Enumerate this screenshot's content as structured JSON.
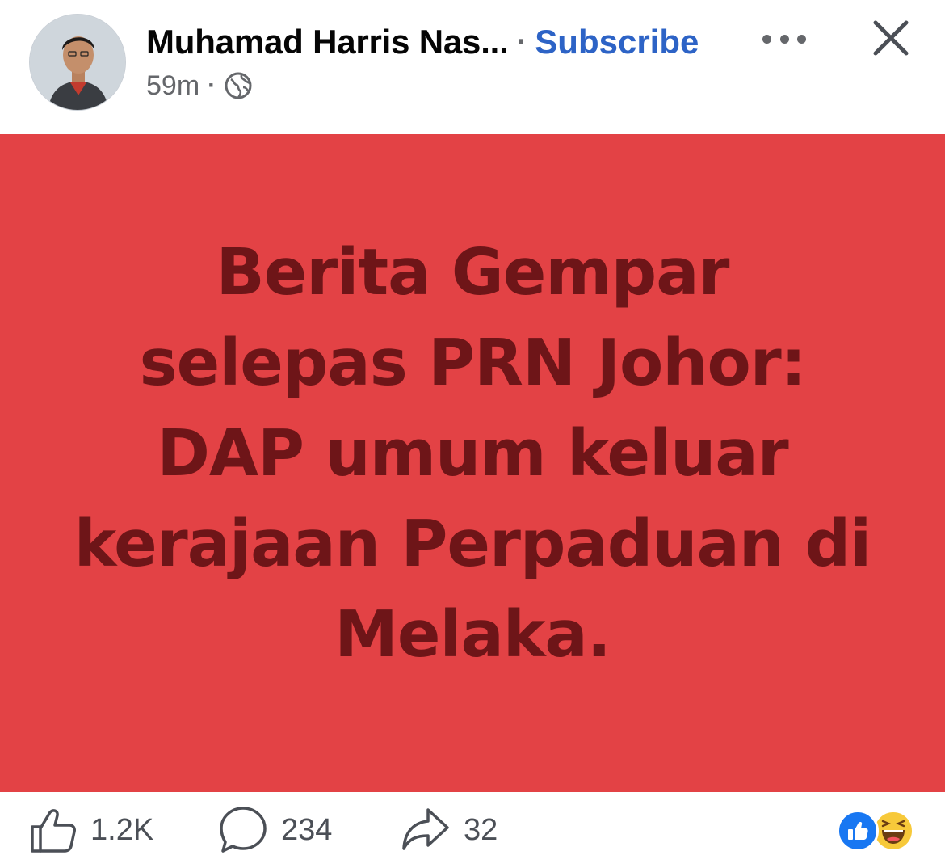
{
  "post": {
    "author_name": "Muhamad Harris Nas...",
    "separator": "·",
    "subscribe_label": "Subscribe",
    "timestamp": "59m",
    "meta_separator": "·",
    "privacy_icon": "globe-icon",
    "body_lines": [
      "Berita Gempar",
      "selepas PRN Johor:",
      "DAP umum keluar",
      "kerajaan Perpaduan di",
      "Melaka."
    ],
    "background_color": "#e34245",
    "text_color": "#6e1518"
  },
  "actions": {
    "like": {
      "icon": "thumbs-up-icon",
      "count": "1.2K"
    },
    "comment": {
      "icon": "comment-bubble-icon",
      "count": "234"
    },
    "share": {
      "icon": "share-arrow-icon",
      "count": "32"
    }
  },
  "reactions": [
    "like-reaction",
    "haha-reaction"
  ],
  "colors": {
    "link": "#2d63c6",
    "secondary_text": "#65676b",
    "like_blue": "#1877f2"
  }
}
